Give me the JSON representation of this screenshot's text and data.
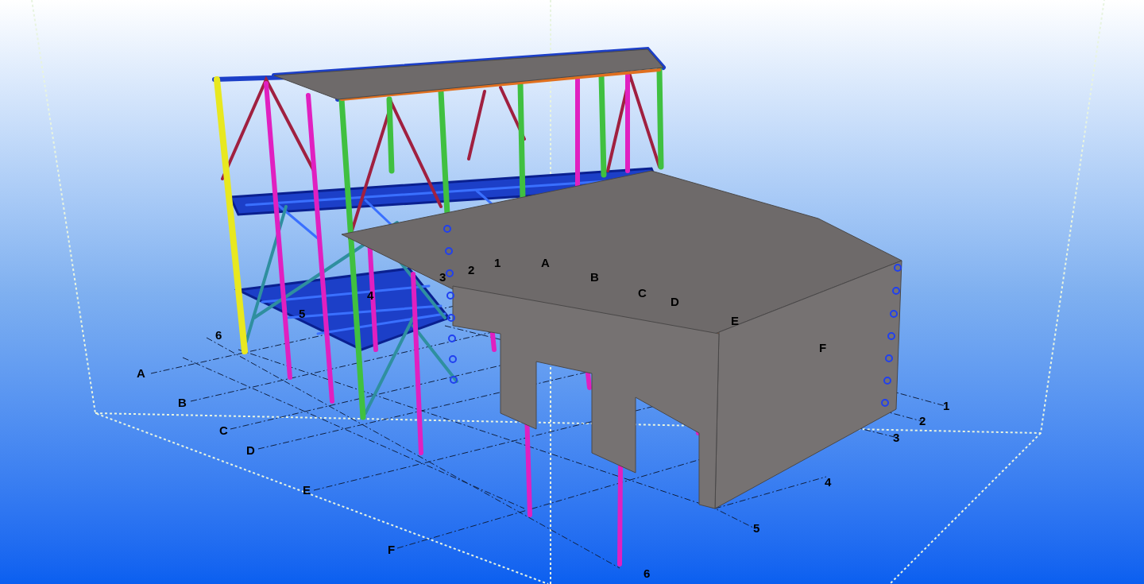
{
  "viewport": {
    "grid_labels": [
      {
        "text": "3"
      },
      {
        "text": "2"
      },
      {
        "text": "1"
      },
      {
        "text": "A"
      },
      {
        "text": "B"
      },
      {
        "text": "C"
      },
      {
        "text": "D"
      },
      {
        "text": "E"
      },
      {
        "text": "F"
      },
      {
        "text": "4"
      },
      {
        "text": "5"
      },
      {
        "text": "6"
      },
      {
        "text": "A"
      },
      {
        "text": "B"
      },
      {
        "text": "C"
      },
      {
        "text": "D"
      },
      {
        "text": "E"
      },
      {
        "text": "F"
      },
      {
        "text": "1"
      },
      {
        "text": "2"
      },
      {
        "text": "3"
      },
      {
        "text": "4"
      },
      {
        "text": "5"
      },
      {
        "text": "6"
      }
    ]
  }
}
